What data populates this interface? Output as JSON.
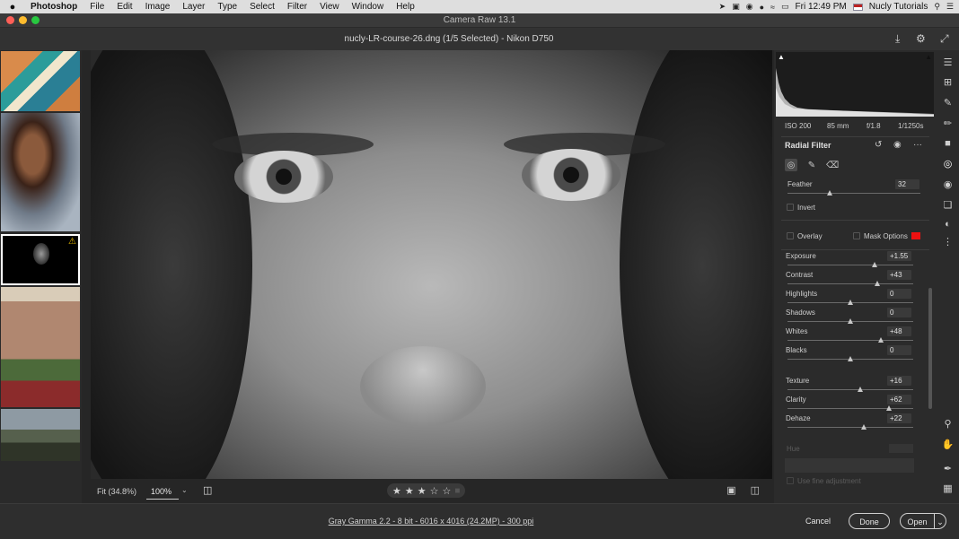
{
  "menubar": {
    "apple": "",
    "app": "Photoshop",
    "items": [
      "File",
      "Edit",
      "Image",
      "Layer",
      "Type",
      "Select",
      "Filter",
      "View",
      "Window",
      "Help"
    ],
    "clock": "Fri 12:49 PM",
    "user": "Nucly Tutorials"
  },
  "window": {
    "title": "Camera Raw 13.1"
  },
  "file": {
    "name": "nucly-LR-course-26.dng  (1/5 Selected)  -  Nikon D750"
  },
  "filmstrip": {
    "count": 5,
    "selected_index": 3,
    "warning_glyph": "⚠"
  },
  "viewer": {
    "fit_label": "Fit (34.8%)",
    "zoom_value": "100%",
    "rating_stars": 3,
    "rating_max": 5
  },
  "exif": {
    "iso": "ISO 200",
    "focal": "85 mm",
    "aperture": "f/1.8",
    "shutter": "1/1250s"
  },
  "panel": {
    "title": "Radial Filter",
    "feather": {
      "label": "Feather",
      "value": "32",
      "fraction": 0.32
    },
    "invert_label": "Invert",
    "overlay_label": "Overlay",
    "mask_options_label": "Mask Options",
    "mask_color": "#ee1111",
    "sliders": [
      {
        "label": "Exposure",
        "value": "+1.55",
        "amount": 1.55,
        "min": -4,
        "max": 4
      },
      {
        "label": "Contrast",
        "value": "+43",
        "amount": 43,
        "min": -100,
        "max": 100
      },
      {
        "label": "Highlights",
        "value": "0",
        "amount": 0,
        "min": -100,
        "max": 100
      },
      {
        "label": "Shadows",
        "value": "0",
        "amount": 0,
        "min": -100,
        "max": 100
      },
      {
        "label": "Whites",
        "value": "+48",
        "amount": 48,
        "min": -100,
        "max": 100
      },
      {
        "label": "Blacks",
        "value": "0",
        "amount": 0,
        "min": -100,
        "max": 100
      },
      {
        "label": "Texture",
        "value": "+16",
        "amount": 16,
        "min": -100,
        "max": 100
      },
      {
        "label": "Clarity",
        "value": "+62",
        "amount": 62,
        "min": -100,
        "max": 100
      },
      {
        "label": "Dehaze",
        "value": "+22",
        "amount": 22,
        "min": -100,
        "max": 100
      }
    ],
    "hue_label": "Hue",
    "fine_label": "Use fine adjustment"
  },
  "footer": {
    "workflow": "Gray Gamma 2.2 - 8 bit - 6016 x 4016 (24.2MP) - 300 ppi",
    "cancel": "Cancel",
    "done": "Done",
    "open": "Open"
  }
}
